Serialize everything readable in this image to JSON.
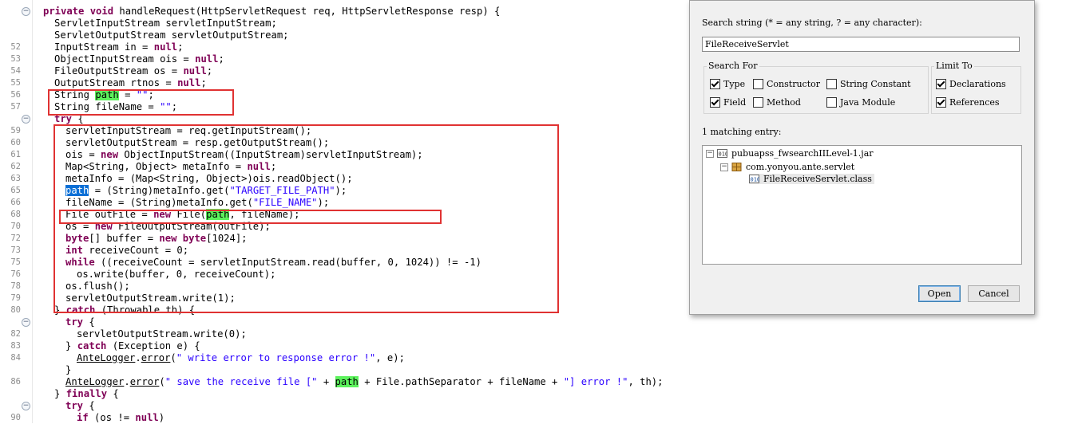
{
  "editor": {
    "lines": [
      {
        "n": "",
        "fold": "-",
        "html": "<span class=\"kw\">private</span> <span class=\"kw\">void</span> handleRequest(HttpServletRequest req, HttpServletResponse resp) {",
        "indent": 54
      },
      {
        "n": "",
        "html": "ServletInputStream servletInputStream;",
        "indent": 68
      },
      {
        "n": "",
        "html": "ServletOutputStream servletOutputStream;",
        "indent": 68
      },
      {
        "n": "52",
        "html": "InputStream in = <span class=\"kw\">null</span>;",
        "indent": 68
      },
      {
        "n": "53",
        "html": "ObjectInputStream ois = <span class=\"kw\">null</span>;",
        "indent": 68
      },
      {
        "n": "54",
        "html": "FileOutputStream os = <span class=\"kw\">null</span>;",
        "indent": 68
      },
      {
        "n": "55",
        "html": "OutputStream rtnos = <span class=\"kw\">null</span>;",
        "indent": 68
      },
      {
        "n": "56",
        "html": "String <span class=\"hlg\">path</span> = <span class=\"str\">\"\"</span>;",
        "indent": 68
      },
      {
        "n": "57",
        "html": "String fileName = <span class=\"str\">\"\"</span>;",
        "indent": 68
      },
      {
        "n": "",
        "fold": "-",
        "html": "<span class=\"kw\">try</span> {",
        "indent": 68
      },
      {
        "n": "59",
        "html": "servletInputStream = req.getInputStream();",
        "indent": 82
      },
      {
        "n": "60",
        "html": "servletOutputStream = resp.getOutputStream();",
        "indent": 82
      },
      {
        "n": "61",
        "html": "ois = <span class=\"kw\">new</span> ObjectInputStream((InputStream)servletInputStream);",
        "indent": 82
      },
      {
        "n": "62",
        "html": "Map&lt;String, Object&gt; metaInfo = <span class=\"kw\">null</span>;",
        "indent": 82
      },
      {
        "n": "63",
        "html": "metaInfo = (Map&lt;String, Object&gt;)ois.readObject();",
        "indent": 82
      },
      {
        "n": "65",
        "html": "<span class=\"hlb\">path</span> = (String)metaInfo.get(<span class=\"str\">\"TARGET_FILE_PATH\"</span>);",
        "indent": 82
      },
      {
        "n": "66",
        "html": "fileName = (String)metaInfo.get(<span class=\"str\">\"FILE_NAME\"</span>);",
        "indent": 82
      },
      {
        "n": "68",
        "html": "File outFile = <span class=\"kw\">new</span> File(<span class=\"hlg\">path</span>, fileName);",
        "indent": 82
      },
      {
        "n": "70",
        "html": "os = <span class=\"kw\">new</span> FileOutputStream(outFile);",
        "indent": 82
      },
      {
        "n": "72",
        "html": "<span class=\"kw\">byte</span>[] buffer = <span class=\"kw\">new</span> <span class=\"kw\">byte</span>[1024];",
        "indent": 82
      },
      {
        "n": "73",
        "html": "<span class=\"kw\">int</span> receiveCount = 0;",
        "indent": 82
      },
      {
        "n": "75",
        "html": "<span class=\"kw\">while</span> ((receiveCount = servletInputStream.read(buffer, 0, 1024)) != -1)",
        "indent": 82
      },
      {
        "n": "76",
        "html": "os.write(buffer, 0, receiveCount);",
        "indent": 96
      },
      {
        "n": "78",
        "html": "os.flush();",
        "indent": 82
      },
      {
        "n": "79",
        "html": "servletOutputStream.write(1);",
        "indent": 82
      },
      {
        "n": "80",
        "html": "} <span class=\"kw\">catch</span> (Throwable th) {",
        "indent": 68
      },
      {
        "n": "",
        "fold": "-",
        "html": "<span class=\"kw\">try</span> {",
        "indent": 82
      },
      {
        "n": "82",
        "html": "servletOutputStream.write(0);",
        "indent": 96
      },
      {
        "n": "83",
        "html": "} <span class=\"kw\">catch</span> (Exception e) {",
        "indent": 82
      },
      {
        "n": "84",
        "html": "<span class=\"ul\">AnteLogger</span>.<span class=\"ul\">error</span>(<span class=\"str\">\" write error to response error !\"</span>, e);",
        "indent": 96
      },
      {
        "n": "",
        "html": "}",
        "indent": 82
      },
      {
        "n": "86",
        "html": "<span class=\"ul\">AnteLogger</span>.<span class=\"ul\">error</span>(<span class=\"str\">\" save the receive file [\"</span> + <span class=\"hlg\">path</span> + File.pathSeparator + fileName + <span class=\"str\">\"] error !\"</span>, th);",
        "indent": 82
      },
      {
        "n": "",
        "html": "} <span class=\"kw\">finally</span> {",
        "indent": 68
      },
      {
        "n": "",
        "fold": "-",
        "html": "<span class=\"kw\">try</span> {",
        "indent": 82
      },
      {
        "n": "90",
        "html": "<span class=\"kw\">if</span> (os != <span class=\"kw\">null</span>)",
        "indent": 96
      }
    ]
  },
  "dialog": {
    "search_label": "Search string (* = any string, ? = any character):",
    "search_value": "FileReceiveServlet",
    "search_for_title": "Search For",
    "limit_to_title": "Limit To",
    "search_for": [
      {
        "label": "Type",
        "checked": true
      },
      {
        "label": "Constructor",
        "checked": false
      },
      {
        "label": "String Constant",
        "checked": false
      },
      {
        "label": "Field",
        "checked": true
      },
      {
        "label": "Method",
        "checked": false
      },
      {
        "label": "Java Module",
        "checked": false
      }
    ],
    "limit_to": [
      {
        "label": "Declarations",
        "checked": true
      },
      {
        "label": "References",
        "checked": true
      }
    ],
    "match_count": "1 matching entry:",
    "tree": {
      "jar": "pubuapss_fwsearchIILevel-1.jar",
      "package": "com.yonyou.ante.servlet",
      "class": "FileReceiveServlet.class"
    },
    "open_label": "Open",
    "cancel_label": "Cancel",
    "colors": {
      "accent": "#3c7fb1",
      "highlight_red": "#e03232",
      "match_green": "#5cf25c",
      "select_blue": "#0a6fd6"
    }
  }
}
